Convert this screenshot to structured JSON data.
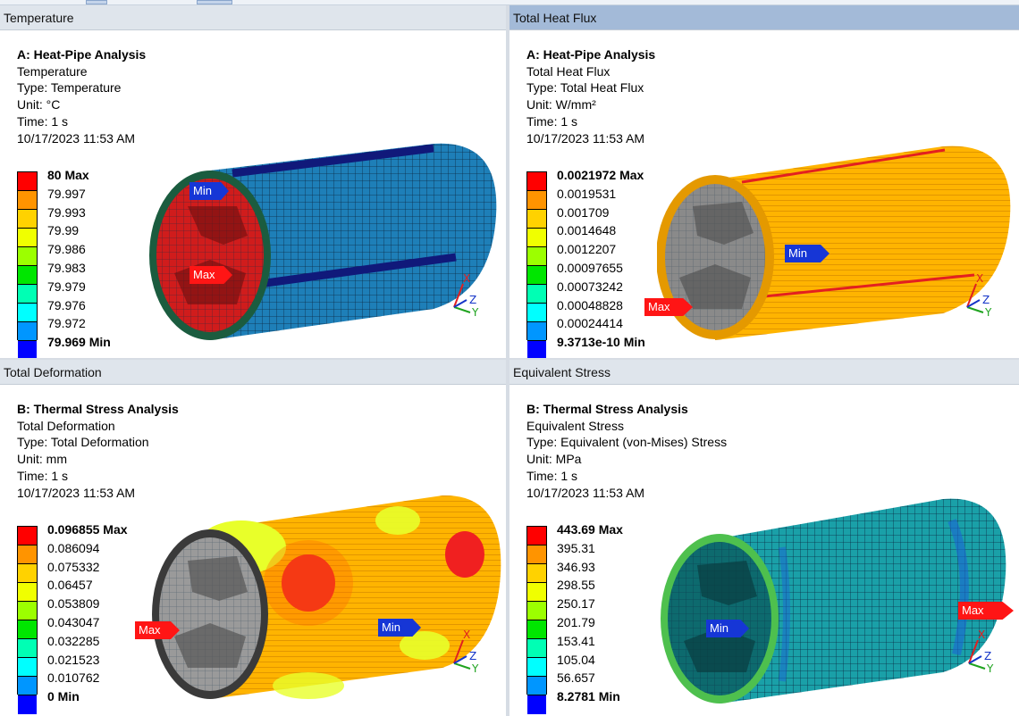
{
  "colors": {
    "legend": [
      "#ff0000",
      "#ff9400",
      "#ffd200",
      "#f0ff00",
      "#9cff00",
      "#00e600",
      "#00ffb4",
      "#00ffff",
      "#0096ff",
      "#0000ff"
    ],
    "min_tag": "#1636d6",
    "max_tag": "#ff1515"
  },
  "panes": {
    "temperature": {
      "title": "Temperature",
      "analysis": "A: Heat-Pipe Analysis",
      "result": "Temperature",
      "type": "Type: Temperature",
      "unit": "Unit: °C",
      "time": "Time: 1 s",
      "date": "10/17/2023 11:53 AM",
      "legend": [
        "80 Max",
        "79.997",
        "79.993",
        "79.99",
        "79.986",
        "79.983",
        "79.979",
        "79.976",
        "79.972",
        "79.969 Min"
      ],
      "min_label": "Min",
      "max_label": "Max"
    },
    "heatflux": {
      "title": "Total Heat Flux",
      "analysis": "A: Heat-Pipe Analysis",
      "result": "Total Heat Flux",
      "type": "Type: Total Heat Flux",
      "unit": "Unit: W/mm²",
      "time": "Time: 1 s",
      "date": "10/17/2023 11:53 AM",
      "legend": [
        "0.0021972 Max",
        "0.0019531",
        "0.001709",
        "0.0014648",
        "0.0012207",
        "0.00097655",
        "0.00073242",
        "0.00048828",
        "0.00024414",
        "9.3713e-10 Min"
      ],
      "min_label": "Min",
      "max_label": "Max"
    },
    "deformation": {
      "title": "Total Deformation",
      "analysis": "B: Thermal Stress Analysis",
      "result": "Total Deformation",
      "type": "Type: Total Deformation",
      "unit": "Unit: mm",
      "time": "Time: 1 s",
      "date": "10/17/2023 11:53 AM",
      "legend": [
        "0.096855 Max",
        "0.086094",
        "0.075332",
        "0.06457",
        "0.053809",
        "0.043047",
        "0.032285",
        "0.021523",
        "0.010762",
        "0 Min"
      ],
      "min_label": "Min",
      "max_label": "Max"
    },
    "stress": {
      "title": "Equivalent Stress",
      "analysis": "B: Thermal Stress Analysis",
      "result": "Equivalent Stress",
      "type": "Type: Equivalent (von-Mises) Stress",
      "unit": "Unit: MPa",
      "time": "Time: 1 s",
      "date": "10/17/2023 11:53 AM",
      "legend": [
        "443.69 Max",
        "395.31",
        "346.93",
        "298.55",
        "250.17",
        "201.79",
        "153.41",
        "105.04",
        "56.657",
        "8.2781 Min"
      ],
      "min_label": "Min",
      "max_label": "Max"
    }
  },
  "axes": {
    "x": "X",
    "y": "Y",
    "z": "Z"
  }
}
